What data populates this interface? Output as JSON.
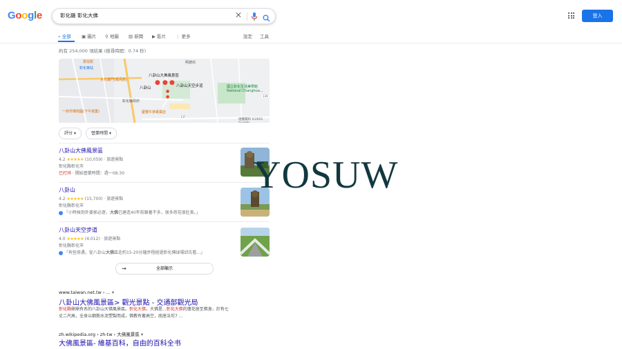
{
  "header": {
    "logo_letters": [
      "G",
      "o",
      "o",
      "g",
      "l",
      "e"
    ],
    "logo_colors": [
      "#4285f4",
      "#ea4335",
      "#fbbc05",
      "#4285f4",
      "#34a853",
      "#ea4335"
    ],
    "query": "彰化縣 彰化大佛",
    "signin_label": "登入"
  },
  "tabs": {
    "items": [
      {
        "label": "全部",
        "icon": "search-icon"
      },
      {
        "label": "圖片",
        "icon": "image-icon"
      },
      {
        "label": "地圖",
        "icon": "map-pin-icon"
      },
      {
        "label": "新聞",
        "icon": "news-icon"
      },
      {
        "label": "影片",
        "icon": "video-icon"
      },
      {
        "label": "更多",
        "icon": "more-vert-icon"
      }
    ],
    "settings_label": "設定",
    "tools_label": "工具"
  },
  "result_stats": "約有 254,000 項結果 (搜尋時間：0.74 秒)",
  "map": {
    "labels": {
      "east_station": "彰化東站",
      "rest_area": "景信駅",
      "mingde": "明德坊",
      "dafo_scenic": "八卦山大佛風景區",
      "baguashan": "八卦山",
      "skywalk": "八卦山天空步道",
      "dajingjie": "大元寶門(鳳鳥館)",
      "museum": "國立彰化生活美學館",
      "museum_en": "National Changhua...",
      "county_govt": "彰化縣政府",
      "night_market": "一商市場肉圓(下午營業)",
      "beef_noodle": "慶豐牛排專賣店",
      "road_137": "137",
      "road_139": "139"
    },
    "attribution": "地圖資料 ©2021 Google"
  },
  "filters": [
    "評分",
    "營業時間"
  ],
  "places": [
    {
      "name": "八卦山大佛風景區",
      "rating": "4.2",
      "stars": "★★★★★",
      "reviews": "(10,059)",
      "category": "· 旅遊景點",
      "address": "彰化縣彰化市",
      "status": "已打烊",
      "hours": " · 開始營業時間：週一08:30"
    },
    {
      "name": "八卦山",
      "rating": "4.2",
      "stars": "★★★★★",
      "reviews": "(15,700)",
      "category": "· 旅遊景點",
      "address": "彰化縣彰化市",
      "review_pre": "「小時候到外婆家必遊，",
      "review_bold": "大佛",
      "review_post": "已建造40年前跟著不多，很多荷花很壯美。」"
    },
    {
      "name": "八卦山天空步道",
      "rating": "4.0",
      "stars": "★★★★★",
      "reviews": "(4,012)",
      "category": "· 旅遊景點",
      "address": "彰化縣彰化市",
      "review_pre": "「有些奇遇，從八卦山",
      "review_bold": "大佛",
      "review_post": "區走約15-20分鐘步程經過彰化傳球場邱氏看...」"
    }
  ],
  "all_places_label": "全部顯示",
  "results": [
    {
      "url": "www.taiwan.net.tw › ...",
      "title": "八卦山大佛風景區> 觀光景點 - 交通部觀光局",
      "snippet_1": "彰化縣",
      "snippet_2": "鼎鼎有名的八卦山大佛風景區。",
      "snippet_3": "彰化大佛",
      "snippet_4": "，大佛是...",
      "snippet_5": "彰化大佛",
      "snippet_6": "的蓮花座至佛身，計有七",
      "snippet_line2": "丈二尺高，全身以鋼筋水泥塑製而成，佛教有著高空，底座法坨7 ..."
    },
    {
      "url": "zh.wikipedia.org › zh-tw › 大佛風景區",
      "title": "大佛風景區- 維基百科，自由的百科全书"
    }
  ],
  "watermark": "YOSUW"
}
